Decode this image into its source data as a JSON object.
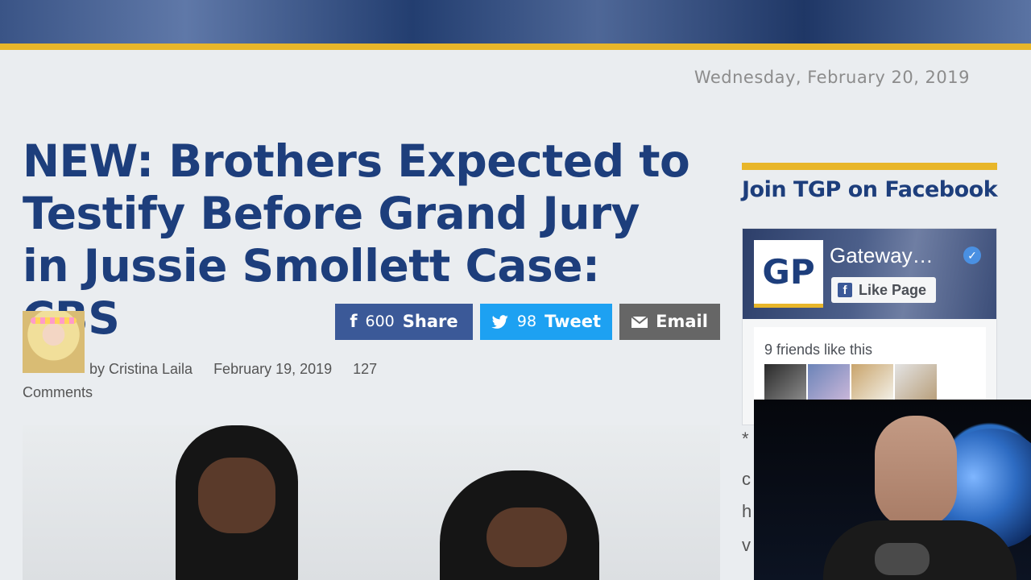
{
  "page_date": "Wednesday, February 20, 2019",
  "article": {
    "title": "NEW: Brothers Expected to Testify Before Grand Jury in Jussie Smollett Case: CBS",
    "author": "by Cristina Laila",
    "date": "February 19, 2019",
    "comments_count": "127",
    "comments_label": "Comments"
  },
  "share": {
    "facebook_count": "600",
    "facebook_label": "Share",
    "twitter_count": "98",
    "twitter_label": "Tweet",
    "email_label": "Email"
  },
  "sidebar": {
    "title": "Join TGP on Facebook",
    "fb_page_name": "Gateway…",
    "fb_logo_text": "GP",
    "fb_like_label": "Like Page",
    "fb_friends_text": "9 friends like this",
    "snippet_1": "*",
    "snippet_2": "c",
    "snippet_3": "h",
    "snippet_4": "v"
  },
  "colors": {
    "accent": "#e8b62a",
    "headline": "#1d3e7c",
    "facebook": "#3b5998",
    "twitter": "#1da1f2",
    "email": "#666666"
  },
  "icons": {
    "facebook": "facebook-icon",
    "twitter": "twitter-icon",
    "email": "email-icon",
    "verified": "verified-icon"
  }
}
